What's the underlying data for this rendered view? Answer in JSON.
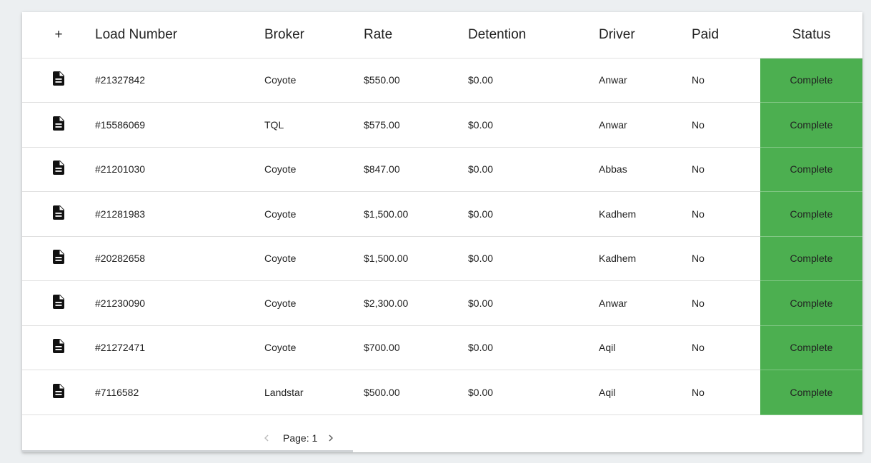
{
  "table": {
    "headers": {
      "add": "+",
      "load_number": "Load Number",
      "broker": "Broker",
      "rate": "Rate",
      "detention": "Detention",
      "driver": "Driver",
      "paid": "Paid",
      "status": "Status"
    },
    "rows": [
      {
        "load_number": "#21327842",
        "broker": "Coyote",
        "rate": "$550.00",
        "detention": "$0.00",
        "driver": "Anwar",
        "paid": "No",
        "status": "Complete"
      },
      {
        "load_number": "#15586069",
        "broker": "TQL",
        "rate": "$575.00",
        "detention": "$0.00",
        "driver": "Anwar",
        "paid": "No",
        "status": "Complete"
      },
      {
        "load_number": "#21201030",
        "broker": "Coyote",
        "rate": "$847.00",
        "detention": "$0.00",
        "driver": "Abbas",
        "paid": "No",
        "status": "Complete"
      },
      {
        "load_number": "#21281983",
        "broker": "Coyote",
        "rate": "$1,500.00",
        "detention": "$0.00",
        "driver": "Kadhem",
        "paid": "No",
        "status": "Complete"
      },
      {
        "load_number": "#20282658",
        "broker": "Coyote",
        "rate": "$1,500.00",
        "detention": "$0.00",
        "driver": "Kadhem",
        "paid": "No",
        "status": "Complete"
      },
      {
        "load_number": "#21230090",
        "broker": "Coyote",
        "rate": "$2,300.00",
        "detention": "$0.00",
        "driver": "Anwar",
        "paid": "No",
        "status": "Complete"
      },
      {
        "load_number": "#21272471",
        "broker": "Coyote",
        "rate": "$700.00",
        "detention": "$0.00",
        "driver": "Aqil",
        "paid": "No",
        "status": "Complete"
      },
      {
        "load_number": "#7116582",
        "broker": "Landstar",
        "rate": "$500.00",
        "detention": "$0.00",
        "driver": "Aqil",
        "paid": "No",
        "status": "Complete"
      }
    ],
    "row_icon": "document-icon"
  },
  "pagination": {
    "label": "Page: 1",
    "prev_icon": "chevron-left-icon",
    "next_icon": "chevron-right-icon"
  },
  "colors": {
    "status_complete": "#4caf50",
    "background": "#eceff1",
    "card": "#ffffff"
  }
}
